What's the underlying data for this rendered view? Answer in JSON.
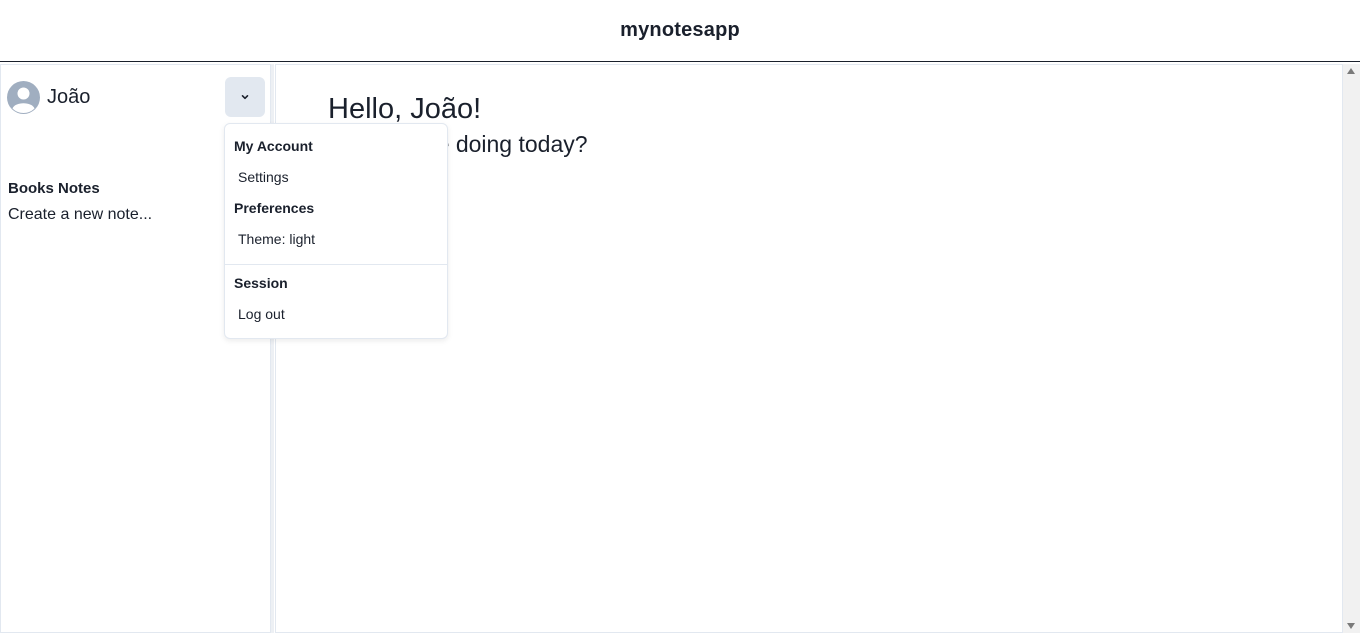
{
  "app": {
    "title": "mynotesapp"
  },
  "user": {
    "name": "João"
  },
  "sidebar": {
    "notebook_title": "Books Notes",
    "new_note_label": "Create a new note..."
  },
  "main": {
    "greeting": "Hello, João!",
    "subgreeting": "How are we doing today?"
  },
  "dropdown": {
    "account_title": "My Account",
    "settings_label": "Settings",
    "preferences_title": "Preferences",
    "theme_label": "Theme: light",
    "session_title": "Session",
    "logout_label": "Log out"
  },
  "icons": {
    "avatar": "user-avatar-icon",
    "menu": "chevron-down-icon"
  },
  "colors": {
    "text": "#1a202c",
    "button_bg": "#e2e8f0",
    "avatar": "#a0aec0"
  }
}
